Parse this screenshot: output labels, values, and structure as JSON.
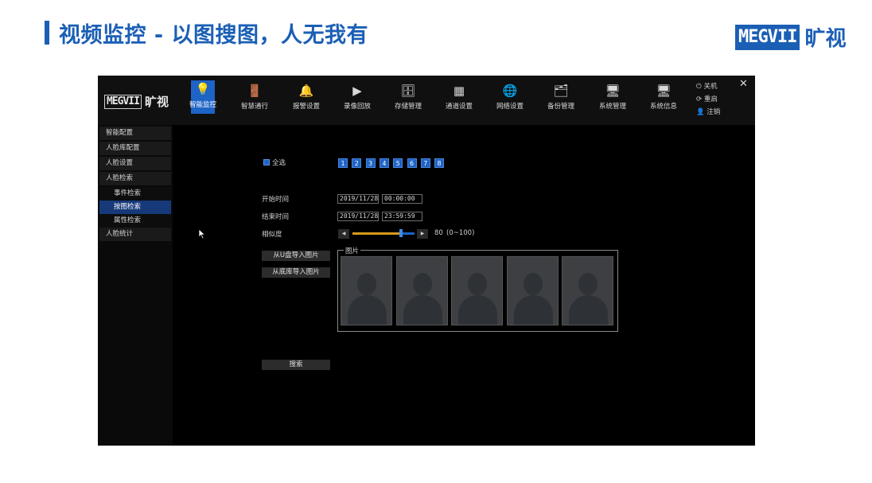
{
  "slide": {
    "title": "视频监控 - 以图搜图，人无我有",
    "brand_box": "MEGVII",
    "brand_cn": "旷视"
  },
  "screen": {
    "logo_box": "MEGVII",
    "logo_cn": "旷视",
    "nav": [
      {
        "label": "智能监控",
        "icon": "lightbulb-icon",
        "glyph": "💡",
        "active": true
      },
      {
        "label": "智慧通行",
        "icon": "door-icon",
        "glyph": "🚪",
        "active": false
      },
      {
        "label": "报警设置",
        "icon": "alarm-icon",
        "glyph": "🔔",
        "active": false
      },
      {
        "label": "录像回放",
        "icon": "play-icon",
        "glyph": "▶",
        "active": false
      },
      {
        "label": "存储管理",
        "icon": "storage-icon",
        "glyph": "🗄",
        "active": false
      },
      {
        "label": "通道设置",
        "icon": "grid-icon",
        "glyph": "▦",
        "active": false
      },
      {
        "label": "网络设置",
        "icon": "globe-icon",
        "glyph": "🌐",
        "active": false
      },
      {
        "label": "备份管理",
        "icon": "backup-icon",
        "glyph": "🗂",
        "active": false
      },
      {
        "label": "系统管理",
        "icon": "monitor-settings-icon",
        "glyph": "🖥",
        "active": false
      },
      {
        "label": "系统信息",
        "icon": "monitor-info-icon",
        "glyph": "🖥",
        "active": false
      }
    ],
    "system": {
      "shutdown": "关机",
      "restart": "重启",
      "logout": "注销",
      "close": "✕"
    },
    "sidebar": [
      {
        "label": "智能配置",
        "level": 0,
        "selected": false
      },
      {
        "label": "人脸库配置",
        "level": 0,
        "selected": false
      },
      {
        "label": "人脸设置",
        "level": 0,
        "selected": false
      },
      {
        "label": "人脸检索",
        "level": 0,
        "selected": false
      },
      {
        "label": "事件检索",
        "level": 1,
        "selected": false
      },
      {
        "label": "按图检索",
        "level": 1,
        "selected": true
      },
      {
        "label": "属性检索",
        "level": 1,
        "selected": false
      },
      {
        "label": "人脸统计",
        "level": 0,
        "selected": false
      }
    ],
    "form": {
      "select_all": "全选",
      "channels": [
        "1",
        "2",
        "3",
        "4",
        "5",
        "6",
        "7",
        "8"
      ],
      "start_label": "开始时间",
      "start_date": "2019/11/28",
      "start_time": "00:00:00",
      "end_label": "结束时间",
      "end_date": "2019/11/28",
      "end_time": "23:59:59",
      "similarity_label": "相似度",
      "similarity_value": "80",
      "similarity_range": "(0~100)",
      "similarity_level": 0.8,
      "import_usb": "从U盘导入图片",
      "import_db": "从底库导入图片",
      "images_legend": "图片",
      "search": "搜索"
    }
  }
}
